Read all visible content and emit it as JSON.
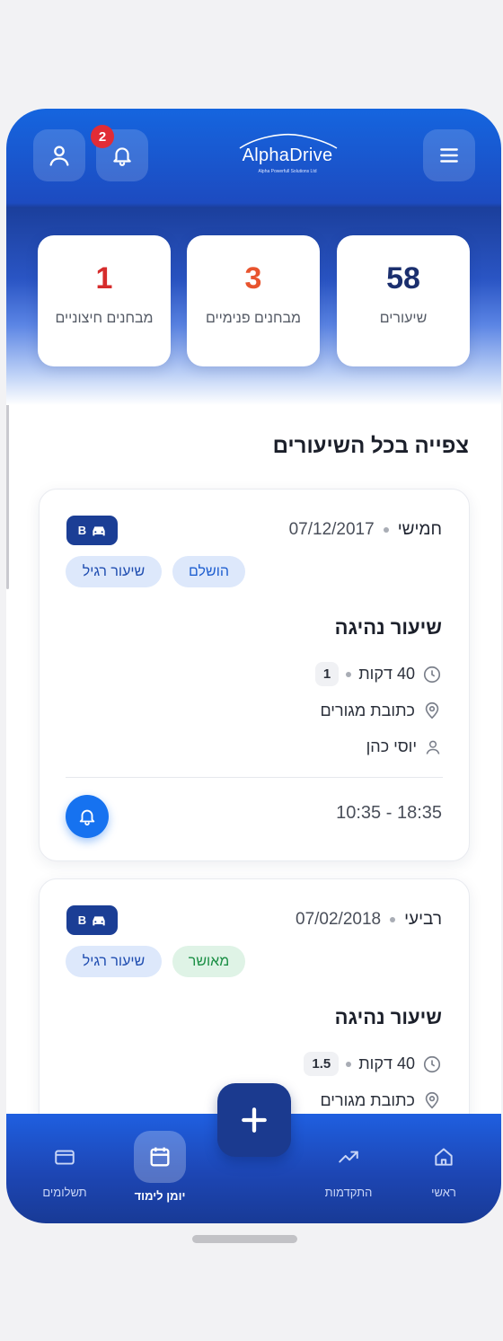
{
  "header": {
    "logo_title": "AlphaDrive",
    "logo_subtitle": "Alpha Powerfull Solutions Ltd",
    "notification_count": "2",
    "icons": {
      "profile": "user-icon",
      "notifications": "bell-icon",
      "menu": "hamburger-menu-icon"
    }
  },
  "stats": [
    {
      "value": "1",
      "label": "מבחנים חיצוניים",
      "color": "#d62c2c"
    },
    {
      "value": "3",
      "label": "מבחנים פנימיים",
      "color": "#e8542e"
    },
    {
      "value": "58",
      "label": "שיעורים",
      "color": "#1b2f6e"
    }
  ],
  "section": {
    "title": "צפייה בכל השיעורים"
  },
  "lessons": [
    {
      "day": "חמישי",
      "date": "07/12/2017",
      "license": "B",
      "status": "הושלם",
      "type": "שיעור רגיל",
      "title": "שיעור נהיגה",
      "duration": "40 דקות",
      "count": "1",
      "location": "כתובת מגורים",
      "teacher": "יוסי כהן",
      "time": "10:35 - 18:35"
    },
    {
      "day": "רביעי",
      "date": "07/02/2018",
      "license": "B",
      "status": "מאושר",
      "type": "שיעור רגיל",
      "title": "שיעור נהיגה",
      "duration": "40 דקות",
      "count": "1.5",
      "location": "כתובת מגורים"
    }
  ],
  "nav": {
    "items": [
      {
        "label": "תשלומים",
        "icon": "credit-card-icon"
      },
      {
        "label": "יומן לימוד",
        "icon": "calendar-icon",
        "active": true
      },
      {
        "label": "התקדמות",
        "icon": "trending-up-icon"
      },
      {
        "label": "ראשי",
        "icon": "home-icon"
      }
    ],
    "fab_icon": "plus-icon"
  },
  "colors": {
    "primary": "#1672f0",
    "navy": "#1b3a8f",
    "status_done": "#1f5fd0",
    "status_approved": "#1b8f45"
  }
}
